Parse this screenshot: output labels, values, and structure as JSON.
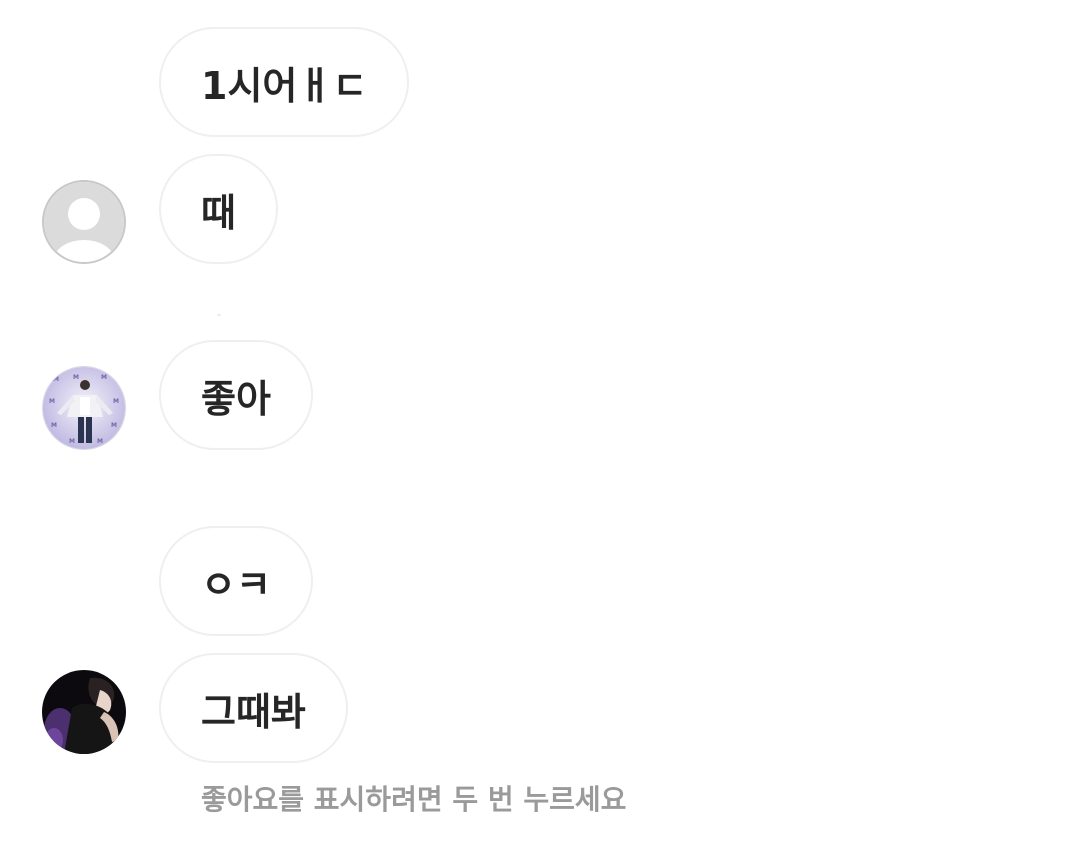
{
  "messages": [
    {
      "text": "1시어ㅐㄷ",
      "avatar": null
    },
    {
      "text": "때",
      "avatar": "default-profile"
    },
    {
      "text": "좋아",
      "avatar": "profile-photo-stage"
    },
    {
      "text": "ㅇㅋ",
      "avatar": null
    },
    {
      "text": "그때봐",
      "avatar": "profile-photo-dark"
    }
  ],
  "hint": "좋아요를 표시하려면 두 번 누르세요",
  "colors": {
    "bubble_border": "#efefef",
    "text": "#262626",
    "hint_text": "#9a9a9a",
    "avatar_placeholder": "#dbdbdb"
  }
}
